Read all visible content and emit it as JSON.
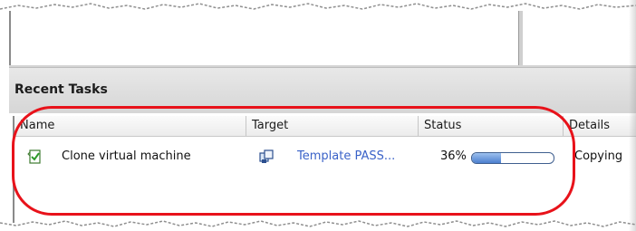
{
  "panel": {
    "title": "Recent Tasks"
  },
  "columns": {
    "name": "Name",
    "target": "Target",
    "status": "Status",
    "details": "Details"
  },
  "task": {
    "name": "Clone virtual machine",
    "name_icon": "clone-task-icon",
    "target": "Template PASS...",
    "target_icon": "virtual-machine-icon",
    "status_percent_text": "36%",
    "status_progress": 0.36,
    "details": "Copying"
  },
  "annotation": {
    "color": "#e8121a"
  },
  "colors": {
    "link": "#3a62c8",
    "progress_fill": "#4b7fcf"
  }
}
